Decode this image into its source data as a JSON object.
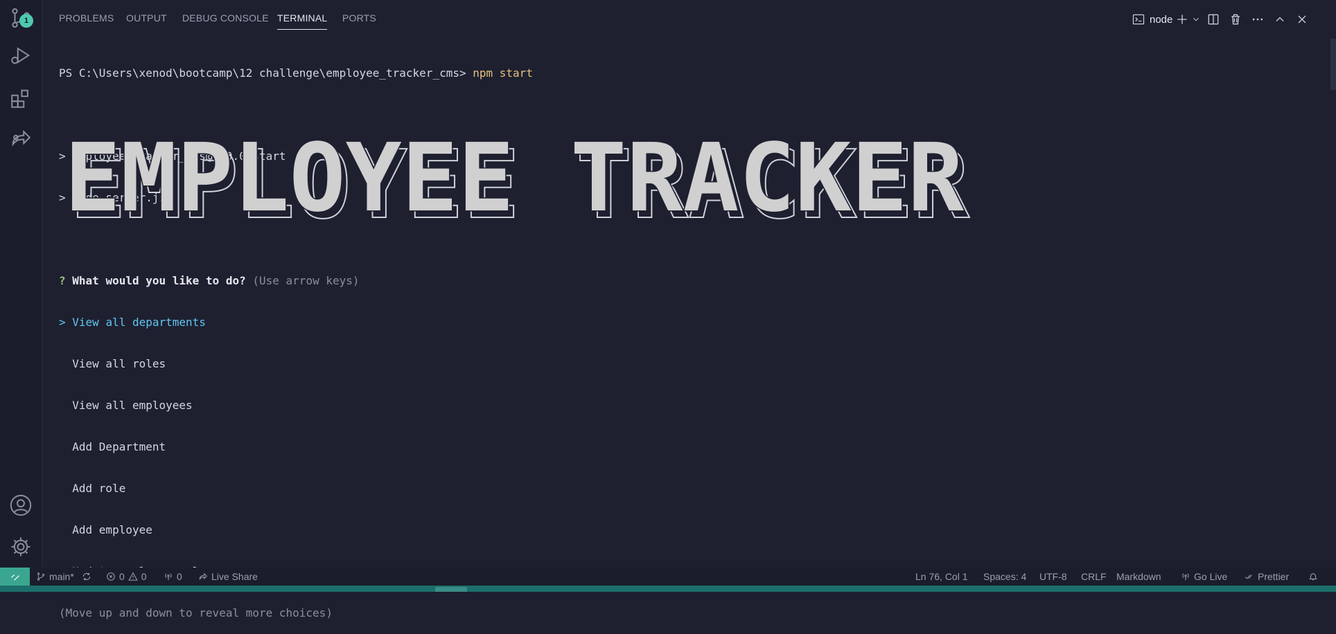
{
  "panel": {
    "tabs": [
      {
        "label": "PROBLEMS"
      },
      {
        "label": "OUTPUT"
      },
      {
        "label": "DEBUG CONSOLE"
      },
      {
        "label": "TERMINAL",
        "active": true
      },
      {
        "label": "PORTS"
      }
    ],
    "terminal_name": "node",
    "icons": [
      "terminal-icon",
      "plus-icon",
      "chevron-down-icon",
      "split-icon",
      "trash-icon",
      "more-icon",
      "maximize-icon",
      "close-icon"
    ]
  },
  "activity_bar": {
    "scm_badge": "1",
    "icons": [
      "source-control-icon",
      "run-debug-icon",
      "extensions-icon",
      "live-share-icon",
      "account-icon",
      "gear-icon"
    ]
  },
  "terminal": {
    "prompt_path": "PS C:\\Users\\xenod\\bootcamp\\12 challenge\\employee_tracker_cms>",
    "command": "npm start",
    "output_line_1": "> employee_tracker_cms@1.0.0 start",
    "output_line_2": "> node server.js",
    "banner_text": "EMPLOYEE TRACKER",
    "question_mark": "?",
    "question": "What would you like to do?",
    "question_hint": "(Use arrow keys)",
    "choices": [
      {
        "label": "View all departments",
        "selected": true
      },
      {
        "label": "View all roles"
      },
      {
        "label": "View all employees"
      },
      {
        "label": "Add Department"
      },
      {
        "label": "Add role"
      },
      {
        "label": "Add employee"
      },
      {
        "label": "Update employee role"
      }
    ],
    "selected_marker": ">",
    "more_hint": "(Move up and down to reveal more choices)"
  },
  "status_bar": {
    "branch": "main*",
    "errors": "0",
    "warnings": "0",
    "ports": "0",
    "live_share": "Live Share",
    "position": "Ln 76, Col 1",
    "spaces": "Spaces: 4",
    "encoding": "UTF-8",
    "eol": "CRLF",
    "language": "Markdown",
    "go_live": "Go Live",
    "prettier": "Prettier"
  },
  "colors": {
    "background": "#1e2030",
    "remote_indicator": "#3aa690",
    "selected_choice": "#61c5f0",
    "command": "#e5c07b",
    "question_mark": "#98c379"
  }
}
